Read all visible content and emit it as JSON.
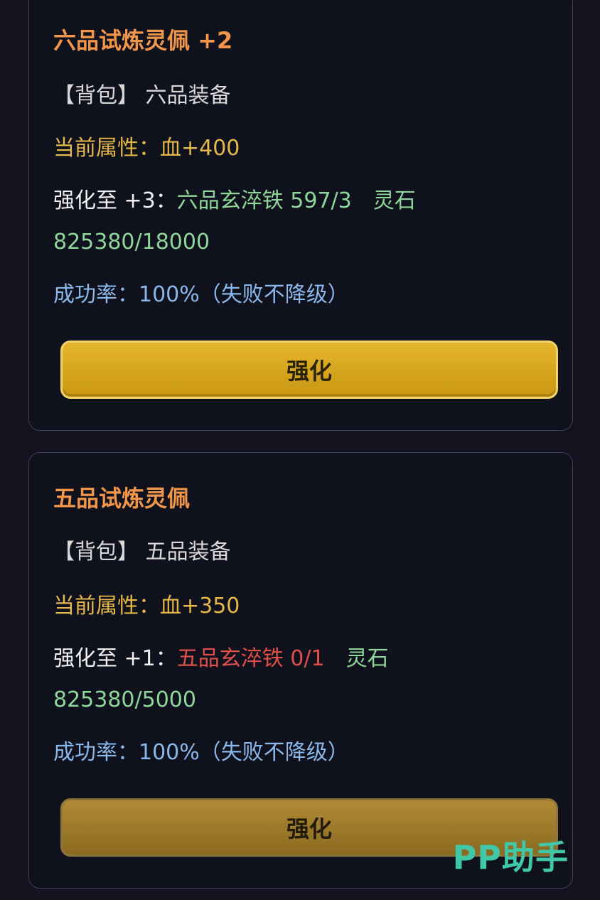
{
  "items": [
    {
      "title": "六品试炼灵佩 +2",
      "bag_label": "【背包】",
      "bag_type": "六品装备",
      "attr_label": "当前属性：",
      "attr_value": "血+400",
      "upgrade_label": "强化至 +3：",
      "material": "六品玄淬铁 597/3",
      "stone_label": "灵石",
      "stone_value": "825380/18000",
      "rate_label": "成功率：",
      "rate_value": "100%（失败不降级）",
      "button": "强化"
    },
    {
      "title": "五品试炼灵佩",
      "bag_label": "【背包】",
      "bag_type": "五品装备",
      "attr_label": "当前属性：",
      "attr_value": "血+350",
      "upgrade_label": "强化至 +1：",
      "material": "五品玄淬铁 0/1",
      "stone_label": "灵石",
      "stone_value": "825380/5000",
      "rate_label": "成功率：",
      "rate_value": "100%（失败不降级）",
      "button": "强化"
    }
  ],
  "watermark": "PP助手",
  "colors": {
    "title": "#f0954a",
    "attr": "#e6b84a",
    "sufficient": "#8fd69a",
    "insufficient": "#e0504a",
    "rate": "#8ab8ea",
    "button": "#e5b52c"
  }
}
